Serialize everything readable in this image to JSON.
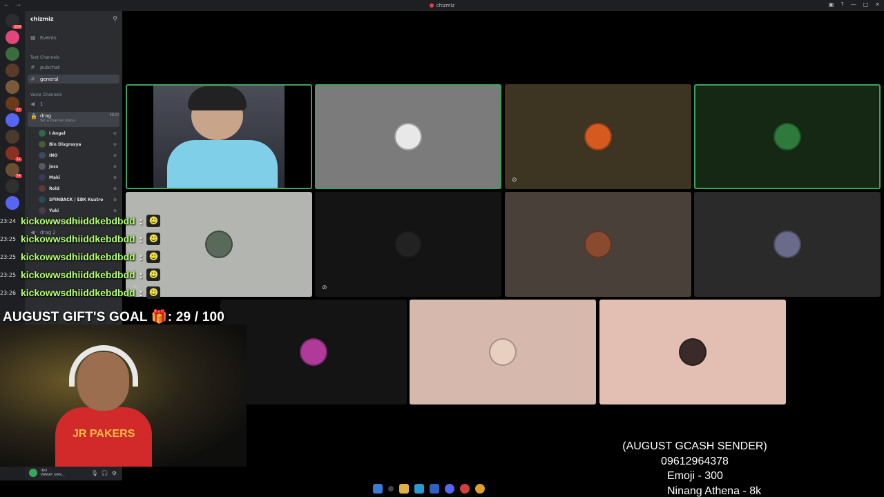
{
  "window": {
    "title": "chizmiz",
    "nav": "← →"
  },
  "servers": [
    {
      "color": "#2b2d31",
      "badge": "169"
    },
    {
      "color": "#e0457b",
      "badge": ""
    },
    {
      "color": "#3d6b3d",
      "badge": ""
    },
    {
      "color": "#5a3a2a",
      "badge": ""
    },
    {
      "color": "#7a5a3a",
      "badge": ""
    },
    {
      "color": "#6a3a1a",
      "badge": "27"
    },
    {
      "color": "#5865f2",
      "badge": ""
    },
    {
      "color": "#4a3a2a",
      "badge": ""
    },
    {
      "color": "#8a3020",
      "badge": "11"
    },
    {
      "color": "#6a5030",
      "badge": "74"
    },
    {
      "color": "#303030",
      "badge": ""
    },
    {
      "color": "#5865f2",
      "badge": ""
    }
  ],
  "sidebar": {
    "server_name": "chizmiz",
    "events": "Events",
    "text_category": "Text Channels",
    "text_channels": [
      "pubchat",
      "general"
    ],
    "voice_category": "Voice Channels",
    "voice_channel_1": "1",
    "voice_active": "drag",
    "voice_active_status": "Set a channel status",
    "voice_timer": "38:07",
    "voice_users": [
      "I Angel",
      "Bin Disgrasya",
      "INO",
      "jess",
      "Maki",
      "Rold",
      "SPINBACK / EBK Kustro",
      "Yuki",
      "boyitsmepotato"
    ],
    "voice_channel_2": "drag 2",
    "userbar_name": "INO",
    "userbar_status": "WARAY GAN..."
  },
  "chat": {
    "username": "kickowwsdhiiddkebdbdd",
    "separator": ":",
    "emoji": "☻",
    "times": [
      "23:24",
      "23:25",
      "23:25",
      "23:25",
      "23:26"
    ]
  },
  "goal": {
    "text": "AUGUST GIFT'S GOAL",
    "icon": "🎁",
    "value": ": 29 / 100"
  },
  "webcam": {
    "jersey": "JR PAKERS"
  },
  "gcash": {
    "title": "(AUGUST GCASH SENDER)",
    "number": "09612964378",
    "line1": "Emoji - 300",
    "line2": "Ninang Athena - 8k"
  },
  "tiles": [
    {
      "bg": "#000000",
      "speaking": true,
      "avatar": ""
    },
    {
      "bg": "#7b7b7b",
      "speaking": true,
      "avatar": "#e8e8e8"
    },
    {
      "bg": "#3e3422",
      "speaking": false,
      "avatar": "#d45a20"
    },
    {
      "bg": "#142814",
      "speaking": true,
      "avatar": "#2e7a3a"
    },
    {
      "bg": "#b3b5b0",
      "speaking": false,
      "avatar": "#5a6a5a"
    },
    {
      "bg": "#141414",
      "speaking": false,
      "avatar": "#222222"
    },
    {
      "bg": "#4a403a",
      "speaking": false,
      "avatar": "#8a4a30"
    },
    {
      "bg": "#2a2a2a",
      "speaking": false,
      "avatar": "#6a6a8a"
    },
    {
      "bg": "#141414",
      "speaking": false,
      "avatar": "#b03a9a"
    },
    {
      "bg": "#d6b8ac",
      "speaking": false,
      "avatar": "#e8d0c0"
    },
    {
      "bg": "#e3bfb3",
      "speaking": false,
      "avatar": "#3a2a2a"
    }
  ]
}
